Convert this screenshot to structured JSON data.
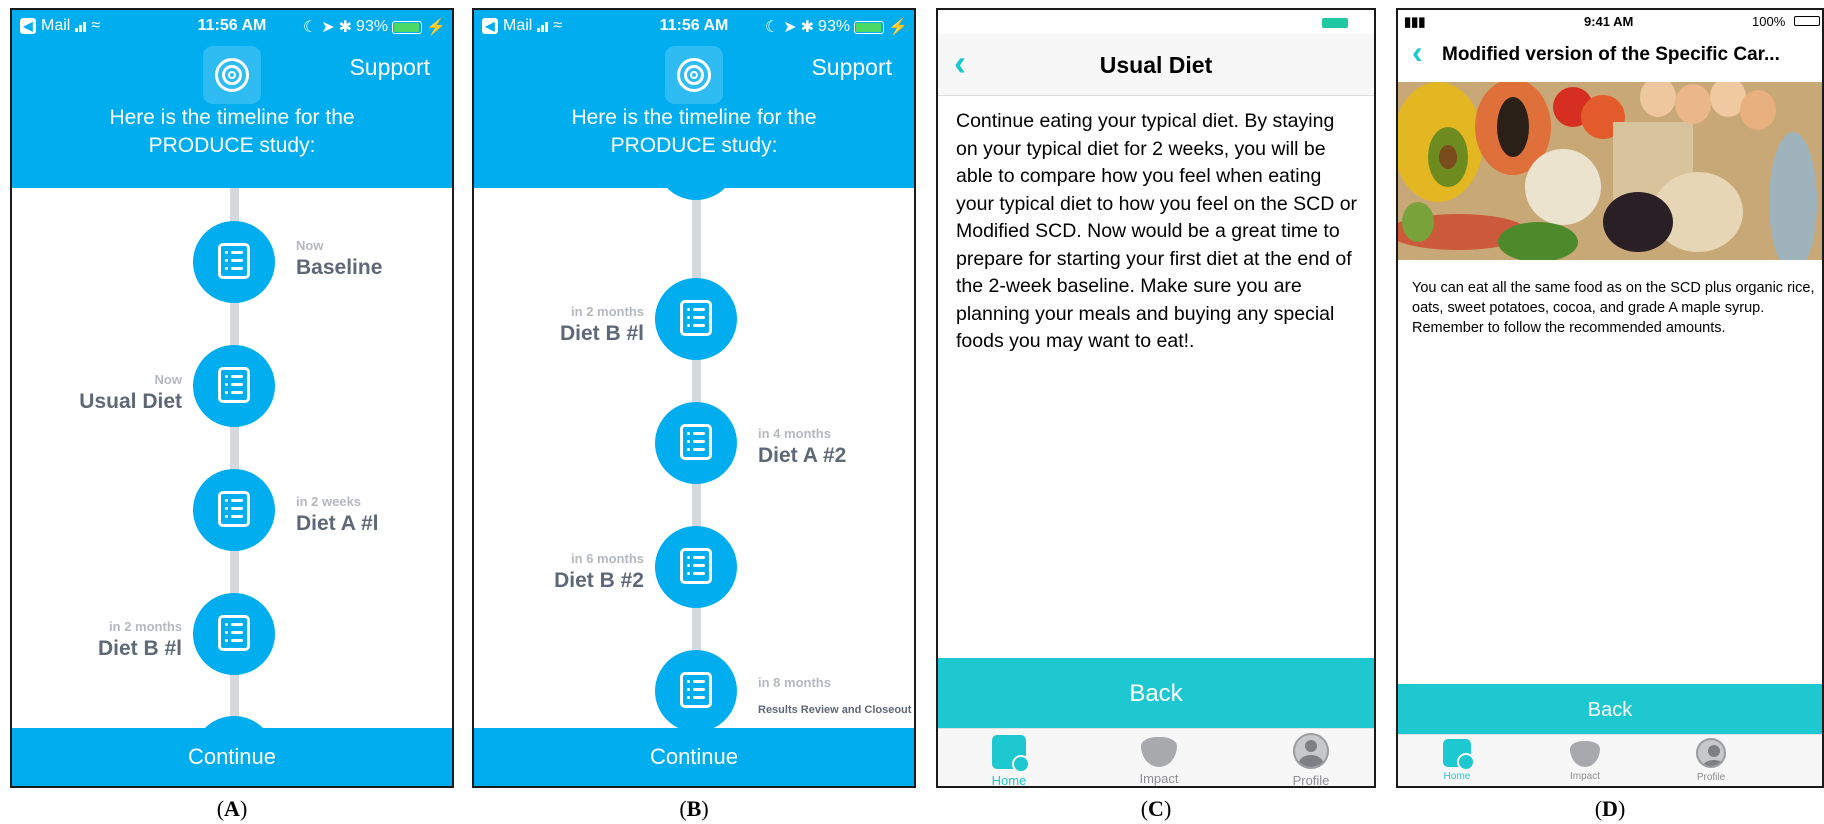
{
  "colors": {
    "blue": "#00aeef",
    "teal": "#1ec8d0",
    "node_text": "#5f6876",
    "when_text": "#b5b8be",
    "line": "#d5d8dc"
  },
  "captions": [
    "A",
    "B",
    "C",
    "D"
  ],
  "panelA": {
    "status": {
      "app": "Mail",
      "time": "11:56 AM",
      "battery": "93%"
    },
    "support": "Support",
    "header_line1": "Here is the timeline for the",
    "header_line2": "PRODUCE study:",
    "timeline": [
      {
        "when": "Now",
        "name": "Baseline"
      },
      {
        "when": "Now",
        "name": "Usual Diet"
      },
      {
        "when": "in 2 weeks",
        "name": "Diet A #l"
      },
      {
        "when": "in 2 months",
        "name": "Diet B #l"
      }
    ],
    "continue": "Continue"
  },
  "panelB": {
    "status": {
      "app": "Mail",
      "time": "11:56 AM",
      "battery": "93%"
    },
    "support": "Support",
    "header_line1": "Here is the timeline for the",
    "header_line2": "PRODUCE study:",
    "timeline": [
      {
        "when": "in 2 months",
        "name": "Diet B #l"
      },
      {
        "when": "in 4 months",
        "name": "Diet A #2"
      },
      {
        "when": "in 6 months",
        "name": "Diet B #2"
      },
      {
        "when": "in 8 months",
        "name": "Results Review and Closeout"
      }
    ],
    "continue": "Continue"
  },
  "panelC": {
    "title": "Usual Diet",
    "body": "Continue eating your typical diet. By staying on your typical diet for 2 weeks, you will be able to compare how you feel when eating your typical diet to how you feel on the SCD or Modified SCD. Now would be a great time to prepare for starting your first diet at the end of the 2-week baseline. Make sure you are planning your meals and buying any special foods you may want to eat!.",
    "back": "Back",
    "tabs": [
      "Home",
      "Impact",
      "Profile"
    ]
  },
  "panelD": {
    "status": {
      "time": "9:41 AM",
      "battery": "100%"
    },
    "title": "Modified version of the Specific Car...",
    "body": "You can eat all the same food as on the SCD plus organic rice, oats, sweet potatoes, cocoa, and grade A maple syrup. Remember to follow the recommended amounts.",
    "back": "Back",
    "tabs": [
      "Home",
      "Impact",
      "Profile"
    ]
  }
}
